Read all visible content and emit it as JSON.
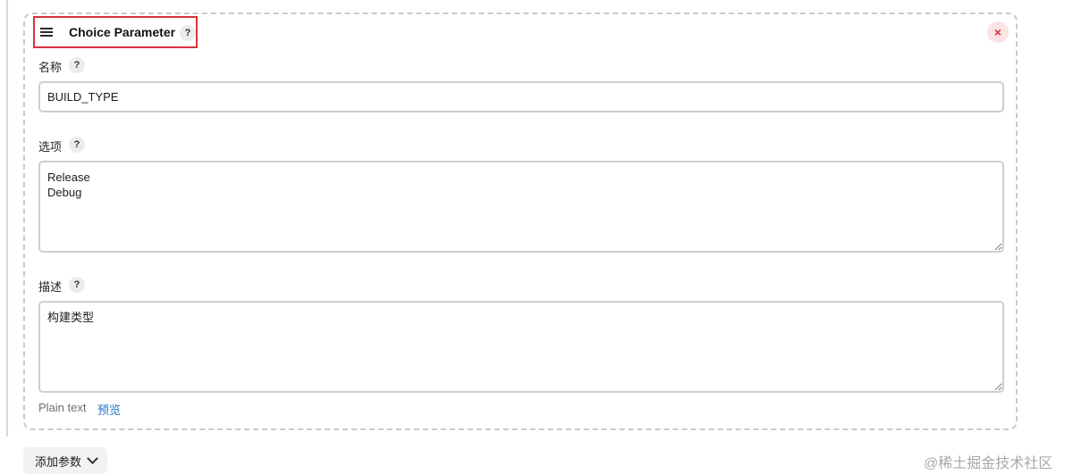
{
  "parameter": {
    "title": "Choice Parameter",
    "help_glyph": "?",
    "close_glyph": "×",
    "name_label": "名称",
    "name_value": "BUILD_TYPE",
    "choices_label": "选项",
    "choices_value": "Release\nDebug",
    "description_label": "描述",
    "description_value": "构建类型",
    "markup_format": "Plain text",
    "preview_link": "预览"
  },
  "add_parameter_label": "添加参数",
  "watermark": "@稀土掘金技术社区",
  "colors": {
    "highlight_border": "#d9333f",
    "close_button_bg": "#fbe3e5",
    "close_button_fg": "#d6303b",
    "link": "#1f74c7"
  }
}
